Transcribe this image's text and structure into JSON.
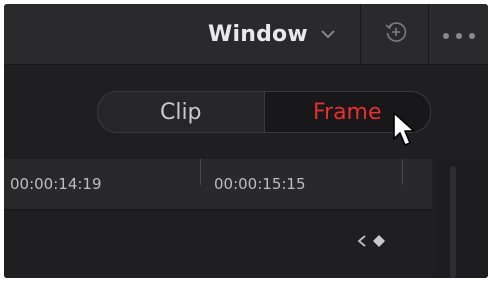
{
  "toolbar": {
    "window_label": "Window"
  },
  "segment": {
    "clip_label": "Clip",
    "frame_label": "Frame",
    "selected": "Frame"
  },
  "ruler": {
    "timecodes": [
      "00:00:14:19",
      "00:00:15:15"
    ]
  },
  "colors": {
    "accent": "#e6302b",
    "background": "#1f1f21",
    "toolbar": "#2a2a2d"
  },
  "icons": [
    "chevron-down-icon",
    "history-icon",
    "more-dots-icon",
    "cursor-pointer-icon",
    "keyframe-prev-icon",
    "keyframe-diamond-icon"
  ]
}
